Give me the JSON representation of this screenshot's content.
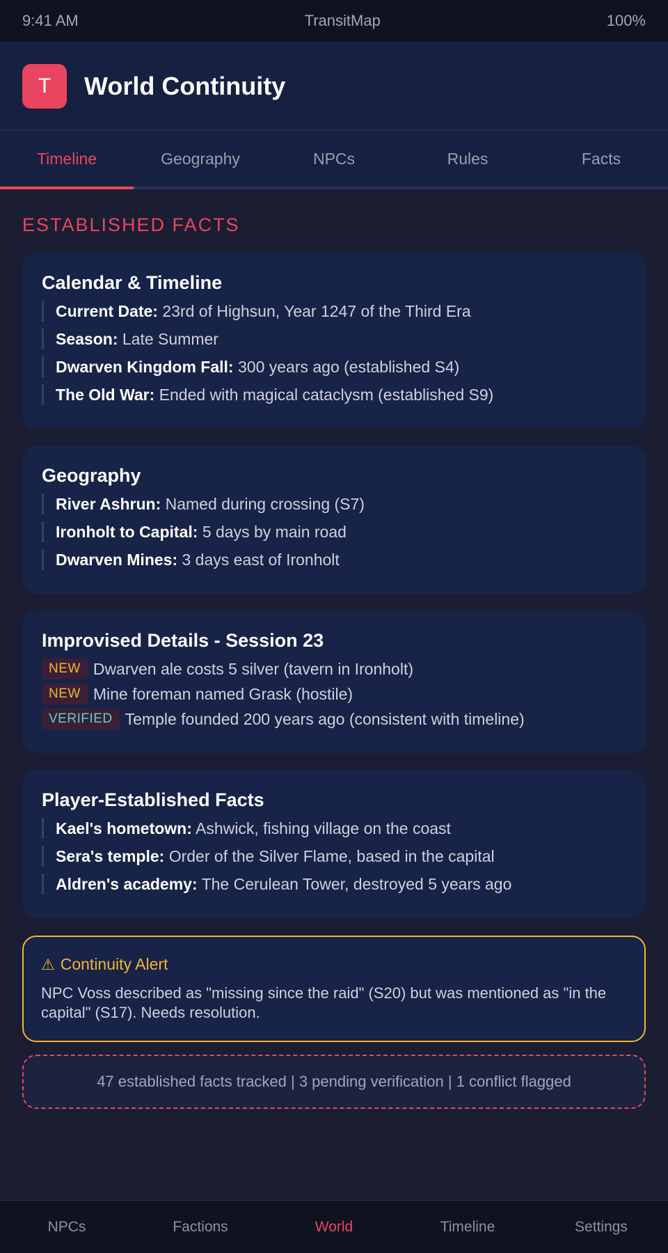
{
  "status_bar": {
    "time": "9:41 AM",
    "app_name": "TransitMap",
    "battery": "100%"
  },
  "header": {
    "logo_letter": "T",
    "title": "World Continuity"
  },
  "tabs": [
    {
      "label": "Timeline",
      "active": true
    },
    {
      "label": "Geography",
      "active": false
    },
    {
      "label": "NPCs",
      "active": false
    },
    {
      "label": "Rules",
      "active": false
    },
    {
      "label": "Facts",
      "active": false
    }
  ],
  "section_title": "ESTABLISHED FACTS",
  "calendar": {
    "title": "Calendar & Timeline",
    "facts": [
      {
        "label": "Current Date:",
        "value": "23rd of Highsun, Year 1247 of the Third Era"
      },
      {
        "label": "Season:",
        "value": "Late Summer"
      },
      {
        "label": "Dwarven Kingdom Fall:",
        "value": "300 years ago (established S4)"
      },
      {
        "label": "The Old War:",
        "value": "Ended with magical cataclysm (established S9)"
      }
    ]
  },
  "geography": {
    "title": "Geography",
    "facts": [
      {
        "label": "River Ashrun:",
        "value": "Named during crossing (S7)"
      },
      {
        "label": "Ironholt to Capital:",
        "value": "5 days by main road"
      },
      {
        "label": "Dwarven Mines:",
        "value": "3 days east of Ironholt"
      }
    ]
  },
  "improvised": {
    "title": "Improvised Details - Session 23",
    "items": [
      {
        "badge": "NEW",
        "text": "Dwarven ale costs 5 silver (tavern in Ironholt)"
      },
      {
        "badge": "NEW",
        "text": "Mine foreman named Grask (hostile)"
      },
      {
        "badge": "VERIFIED",
        "text": "Temple founded 200 years ago (consistent with timeline)"
      }
    ]
  },
  "player_facts": {
    "title": "Player-Established Facts",
    "facts": [
      {
        "label": "Kael's hometown:",
        "value": "Ashwick, fishing village on the coast"
      },
      {
        "label": "Sera's temple:",
        "value": "Order of the Silver Flame, based in the capital"
      },
      {
        "label": "Aldren's academy:",
        "value": "The Cerulean Tower, destroyed 5 years ago"
      }
    ]
  },
  "alert": {
    "icon": "⚠",
    "title": "Continuity Alert",
    "body": "NPC Voss described as \"missing since the raid\" (S20) but was mentioned as \"in the capital\" (S17). Needs resolution."
  },
  "summary": "47 established facts tracked | 3 pending verification | 1 conflict flagged",
  "bottom_nav": [
    {
      "label": "NPCs",
      "active": false
    },
    {
      "label": "Factions",
      "active": false
    },
    {
      "label": "World",
      "active": true
    },
    {
      "label": "Timeline",
      "active": false
    },
    {
      "label": "Settings",
      "active": false
    }
  ],
  "colors": {
    "accent": "#e94560",
    "warning": "#f2b630",
    "verified": "#5fd1c2",
    "card": "#172347",
    "background": "#1b1d33"
  }
}
